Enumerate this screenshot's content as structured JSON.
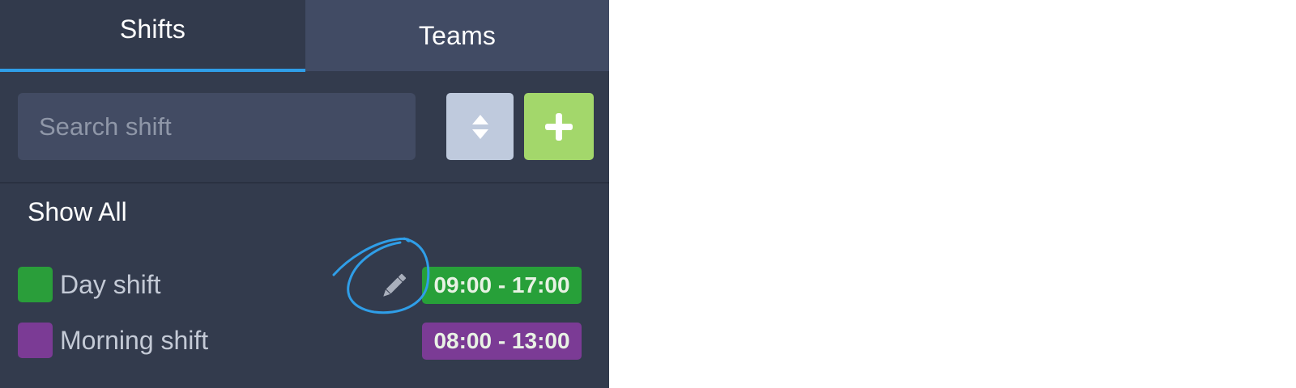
{
  "tabs": [
    {
      "label": "Shifts",
      "active": true
    },
    {
      "label": "Teams",
      "active": false
    }
  ],
  "search": {
    "placeholder": "Search shift",
    "value": ""
  },
  "toolbar": {
    "sort_icon": "sort-updown-icon",
    "add_icon": "plus-icon"
  },
  "filter": {
    "show_all_label": "Show All"
  },
  "shifts": [
    {
      "name": "Day shift",
      "time": "09:00 - 17:00",
      "color": "#2a9e3a",
      "badge_color": "#27a039",
      "edit_icon": "pencil-icon"
    },
    {
      "name": "Morning shift",
      "time": "08:00 - 13:00",
      "color": "#7b3b95",
      "badge_color": "#7b3b95"
    }
  ],
  "colors": {
    "panel_bg": "#333b4d",
    "tab_active_indicator": "#2f9ee8",
    "add_button": "#a3d76b",
    "sort_button": "#bfcadd",
    "annotation": "#2f9ee8"
  }
}
